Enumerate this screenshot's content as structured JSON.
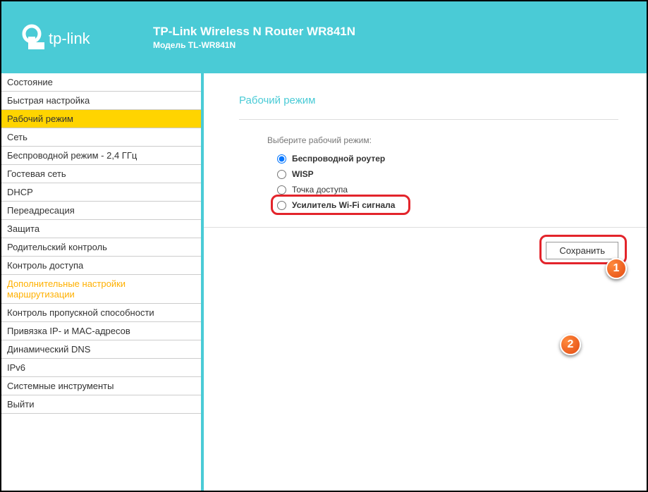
{
  "header": {
    "brand": "tp-link",
    "title": "TP-Link Wireless N Router WR841N",
    "subtitle": "Модель TL-WR841N"
  },
  "sidebar": {
    "items": [
      {
        "label": "Состояние",
        "active": false,
        "highlight": false
      },
      {
        "label": "Быстрая настройка",
        "active": false,
        "highlight": false
      },
      {
        "label": "Рабочий режим",
        "active": true,
        "highlight": false
      },
      {
        "label": "Сеть",
        "active": false,
        "highlight": false
      },
      {
        "label": "Беспроводной режим - 2,4 ГГц",
        "active": false,
        "highlight": false
      },
      {
        "label": "Гостевая сеть",
        "active": false,
        "highlight": false
      },
      {
        "label": "DHCP",
        "active": false,
        "highlight": false
      },
      {
        "label": "Переадресация",
        "active": false,
        "highlight": false
      },
      {
        "label": "Защита",
        "active": false,
        "highlight": false
      },
      {
        "label": "Родительский контроль",
        "active": false,
        "highlight": false
      },
      {
        "label": "Контроль доступа",
        "active": false,
        "highlight": false
      },
      {
        "label": "Дополнительные настройки маршрутизации",
        "active": false,
        "highlight": true
      },
      {
        "label": "Контроль пропускной способности",
        "active": false,
        "highlight": false
      },
      {
        "label": "Привязка IP- и MAC-адресов",
        "active": false,
        "highlight": false
      },
      {
        "label": "Динамический DNS",
        "active": false,
        "highlight": false
      },
      {
        "label": "IPv6",
        "active": false,
        "highlight": false
      },
      {
        "label": "Системные инструменты",
        "active": false,
        "highlight": false
      },
      {
        "label": "Выйти",
        "active": false,
        "highlight": false
      }
    ]
  },
  "content": {
    "title": "Рабочий режим",
    "prompt": "Выберите рабочий режим:",
    "options": [
      {
        "label": "Беспроводной роутер",
        "checked": true,
        "bold": true,
        "highlighted": false
      },
      {
        "label": "WISP",
        "checked": false,
        "bold": true,
        "highlighted": false
      },
      {
        "label": "Точка доступа",
        "checked": false,
        "bold": false,
        "highlighted": false
      },
      {
        "label": "Усилитель Wi-Fi сигнала",
        "checked": false,
        "bold": true,
        "highlighted": true
      }
    ],
    "save_label": "Сохранить"
  },
  "callouts": {
    "one": "1",
    "two": "2"
  }
}
